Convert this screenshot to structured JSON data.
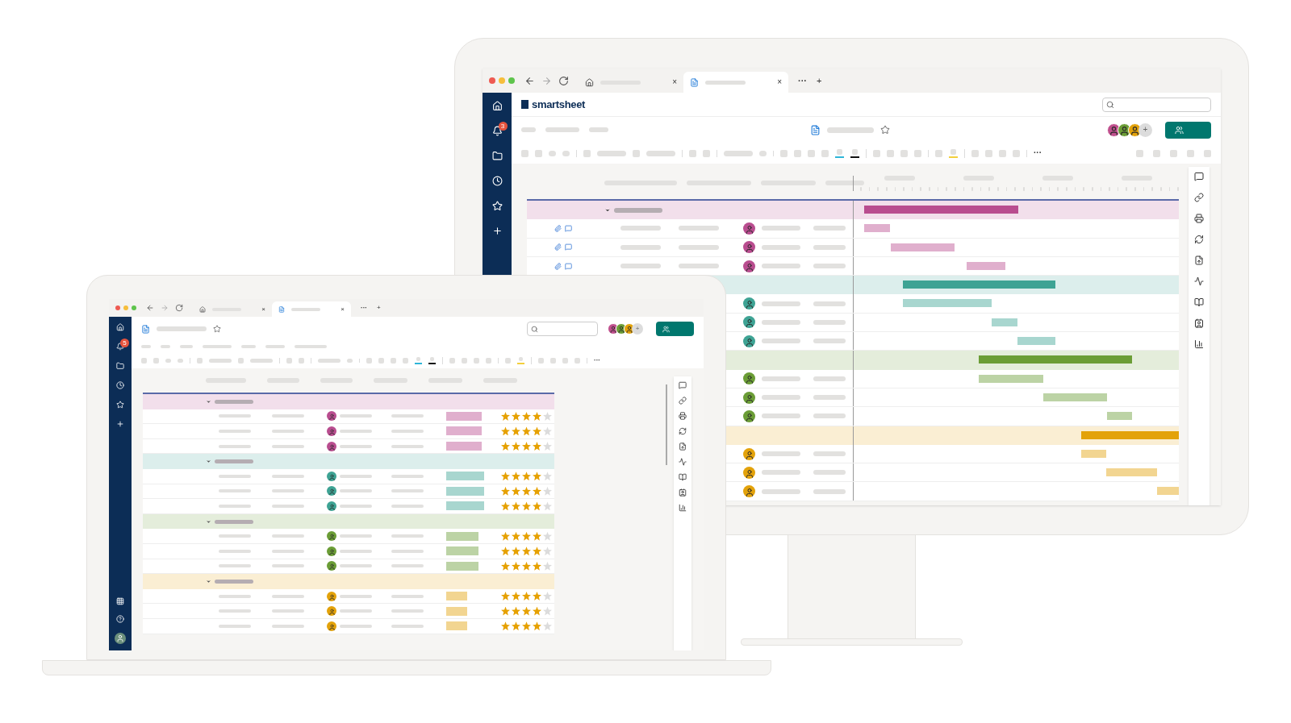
{
  "monitor": {
    "browser": {
      "tabs": [
        {
          "close": "×",
          "selected": false
        },
        {
          "close": "×",
          "selected": true
        }
      ],
      "more": "···",
      "new_tab": "+"
    },
    "logo": "smartsheet",
    "notification_badge": "3",
    "add_collaborator": "+",
    "toolbar_more": "···"
  },
  "laptop": {
    "browser": {
      "tabs": [
        {
          "close": "×",
          "selected": false
        },
        {
          "close": "×",
          "selected": true
        }
      ],
      "more": "···",
      "new_tab": "+"
    },
    "notification_badge": "5",
    "add_collaborator": "+",
    "toolbar_more": "···"
  },
  "sheet": {
    "groups": [
      {
        "color": "#b94d8f",
        "expanded": true,
        "rows": [
          {
            "stars": 4
          },
          {
            "stars": 4
          },
          {
            "stars": 4
          }
        ]
      },
      {
        "color": "#3ea394",
        "expanded": true,
        "rows": [
          {
            "stars": 4
          },
          {
            "stars": 4
          },
          {
            "stars": 4
          }
        ]
      },
      {
        "color": "#6b9d36",
        "expanded": true,
        "rows": [
          {
            "stars": 4
          },
          {
            "stars": 4
          },
          {
            "stars": 4
          }
        ]
      },
      {
        "color": "#e3a20a",
        "expanded": true,
        "rows": [
          {
            "stars": 4
          },
          {
            "stars": 4
          },
          {
            "stars": 4
          }
        ]
      }
    ]
  }
}
